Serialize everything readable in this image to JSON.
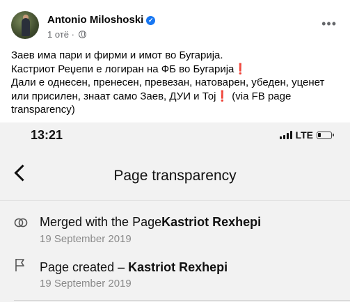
{
  "post": {
    "author": "Antonio Miloshoski",
    "time": "1 отё",
    "lines": [
      "Заев има пари и фирми и имот во Бугарија.",
      "Кастриот Реџепи е логиран на ФБ во Бугарија",
      "Дали е однесен, пренесен, превезан, натоварен, убеден, уценет",
      "или присилен, знаат само Заев, ДУИ и Тој",
      "(via FB page",
      "transparency)"
    ],
    "exclamation": "❗"
  },
  "screenshot": {
    "time": "13:21",
    "network": "LTE",
    "title": "Page transparency",
    "rows": [
      {
        "label": "Merged with the Page",
        "bold": "Kastriot Rexhepi",
        "date": "19 September 2019"
      },
      {
        "label": "Page created – ",
        "bold": "Kastriot Rexhepi",
        "date": "19 September 2019"
      }
    ]
  },
  "icons": {
    "verified": "verified-badge-icon",
    "globe": "globe-icon",
    "more": "more-options-icon",
    "back": "back-chevron-icon",
    "merge": "merge-icon",
    "flag": "flag-icon"
  },
  "colors": {
    "verified": "#1877f2",
    "exclamation": "#e02424",
    "meta": "#65676b"
  }
}
